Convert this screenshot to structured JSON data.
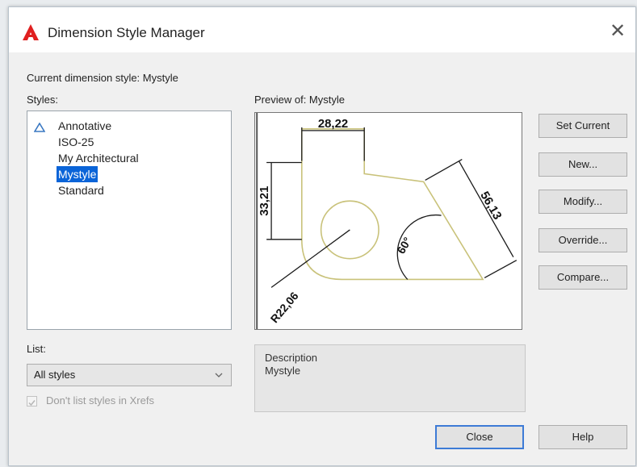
{
  "window": {
    "title": "Dimension Style Manager",
    "close_glyph": "✕"
  },
  "current_style": {
    "label": "Current dimension style: Mystyle"
  },
  "styles": {
    "label": "Styles:",
    "items": [
      "Annotative",
      "ISO-25",
      "My Architectural",
      "Mystyle",
      "Standard"
    ],
    "selected": "Mystyle"
  },
  "preview": {
    "label": "Preview of: Mystyle",
    "dims": {
      "top": "28,22",
      "left": "33,21",
      "right": "56,13",
      "angle": "60°",
      "radius": "R22,06"
    }
  },
  "description": {
    "label": "Description",
    "value": "Mystyle"
  },
  "list": {
    "label": "List:",
    "selected": "All styles"
  },
  "xrefs_checkbox": {
    "label": "Don't list styles in Xrefs",
    "checked": true,
    "enabled": false
  },
  "buttons": {
    "set_current": "Set Current",
    "new": "New...",
    "modify": "Modify...",
    "override": "Override...",
    "compare": "Compare...",
    "close": "Close",
    "help": "Help"
  },
  "colors": {
    "selection": "#0a64d8",
    "logo": "#e02020",
    "geometry": "#c9c27a"
  },
  "icons": [
    "autocad-logo-icon",
    "close-icon",
    "annotative-icon",
    "chevron-down-icon",
    "checkbox-icon"
  ]
}
